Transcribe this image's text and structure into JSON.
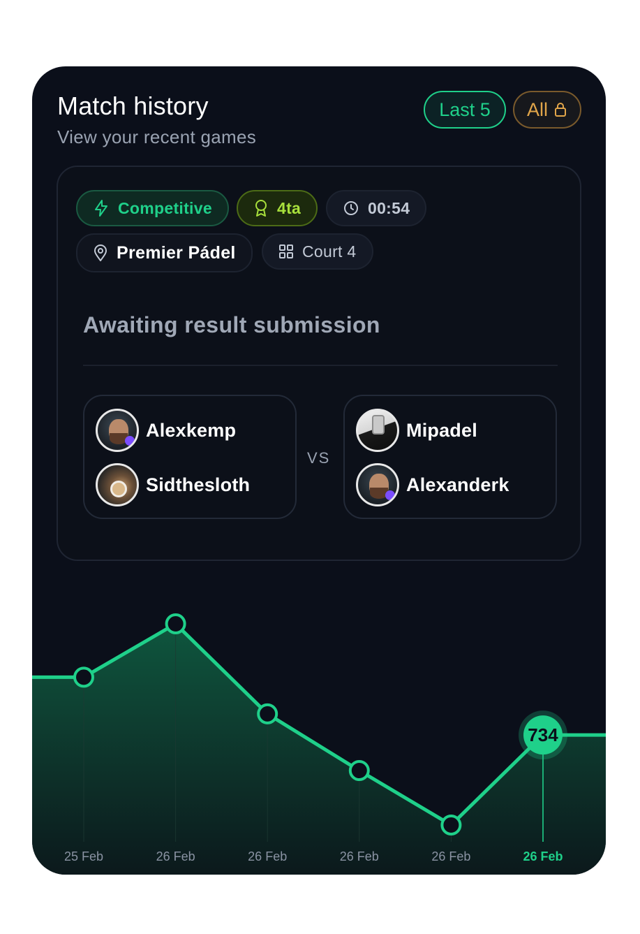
{
  "header": {
    "title": "Match history",
    "subtitle": "View your recent games",
    "filters": {
      "last5_label": "Last 5",
      "all_label": "All",
      "all_icon": "lock-icon"
    }
  },
  "match": {
    "tags": {
      "type": {
        "label": "Competitive",
        "icon": "lightning-icon"
      },
      "rank": {
        "label": "4ta",
        "icon": "award-icon"
      },
      "time": {
        "label": "00:54",
        "icon": "clock-icon"
      },
      "venue": {
        "label": "Premier Pádel",
        "icon": "location-pin-icon"
      },
      "court": {
        "label": "Court 4",
        "icon": "grid-icon"
      }
    },
    "status": "Awaiting result submission",
    "vs_label": "VS",
    "team_a": [
      {
        "name": "Alexkemp"
      },
      {
        "name": "Sidthesloth"
      }
    ],
    "team_b": [
      {
        "name": "Mipadel"
      },
      {
        "name": "Alexanderk"
      }
    ]
  },
  "colors": {
    "accent": "#1fd08a",
    "card_bg": "#0b0f1a",
    "locked": "#e2a64a",
    "rank": "#a8e03c"
  },
  "chart_data": {
    "type": "line",
    "x": [
      "25 Feb",
      "26 Feb",
      "26 Feb",
      "26 Feb",
      "26 Feb",
      "26 Feb"
    ],
    "values": [
      786,
      834,
      753,
      702,
      653,
      734
    ],
    "highlight_index": 5,
    "highlight_label": "734",
    "area_fill": true
  }
}
